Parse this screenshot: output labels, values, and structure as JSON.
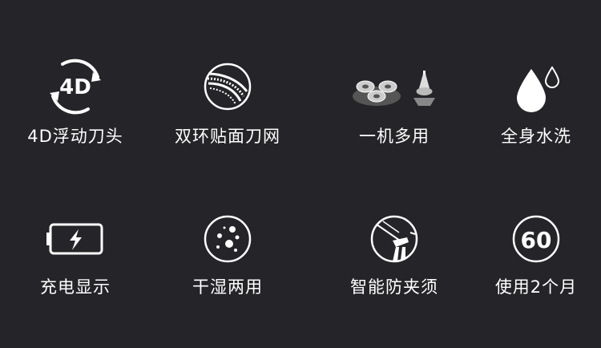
{
  "features": [
    {
      "label": "4D浮动刀头",
      "icon": "4d-rotate-icon"
    },
    {
      "label": "双环贴面刀网",
      "icon": "double-ring-blade-icon"
    },
    {
      "label": "一机多用",
      "icon": "multi-head-shaver-icon"
    },
    {
      "label": "全身水洗",
      "icon": "water-drop-icon"
    },
    {
      "label": "充电显示",
      "icon": "battery-charge-icon"
    },
    {
      "label": "干湿两用",
      "icon": "wet-dry-icon"
    },
    {
      "label": "智能防夹须",
      "icon": "anti-pinch-blade-icon"
    },
    {
      "label": "使用2个月",
      "icon": "sixty-days-icon"
    }
  ],
  "badges": {
    "fourd_text": "4D",
    "sixty_text": "60"
  },
  "colors": {
    "background": "#252428",
    "foreground": "#ffffff"
  }
}
